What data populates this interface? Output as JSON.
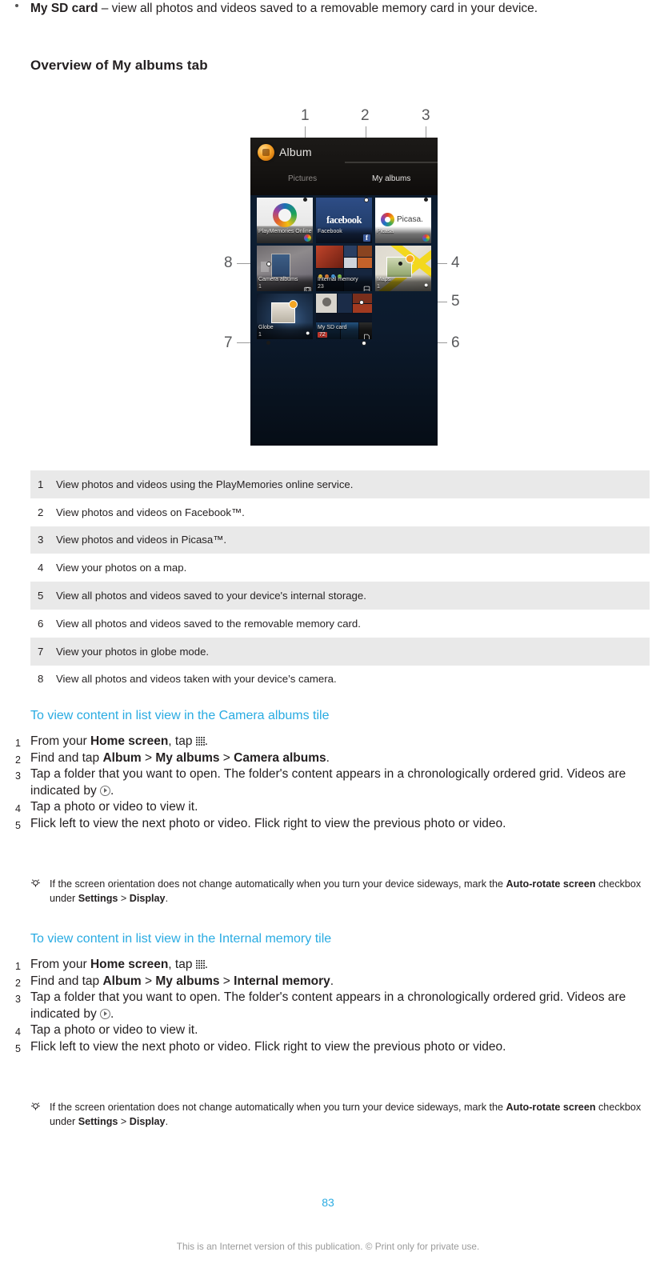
{
  "bullet": {
    "term": "My SD card",
    "rest": " – view all photos and videos saved to a removable memory card in your device."
  },
  "heading": "Overview of My albums tab",
  "figure": {
    "callout_numbers": [
      "1",
      "2",
      "3",
      "4",
      "5",
      "6",
      "7",
      "8"
    ],
    "app": {
      "title": "Album",
      "tabs": [
        {
          "label": "Pictures",
          "selected": false
        },
        {
          "label": "My albums",
          "selected": true
        }
      ],
      "tiles": [
        {
          "label": "PlayMemories Online",
          "count": "",
          "badge": "playmemories-icon"
        },
        {
          "label": "Facebook",
          "count": "",
          "badge": "facebook-icon"
        },
        {
          "label": "Picasa",
          "count": "",
          "badge": "picasa-icon"
        },
        {
          "label": "Camera albums",
          "count": "1",
          "badge": "camera-icon"
        },
        {
          "label": "Internal memory",
          "count": "23",
          "badge": "storage-icon"
        },
        {
          "label": "Maps",
          "count": "1",
          "badge": "pin-icon"
        },
        {
          "label": "Globe",
          "count": "1",
          "badge": "pin-icon"
        },
        {
          "label": "My SD card",
          "count": "72",
          "badge": "sdcard-icon"
        }
      ]
    }
  },
  "table": {
    "rows": [
      {
        "num": "1",
        "text": "View photos and videos using the PlayMemories online service."
      },
      {
        "num": "2",
        "text": "View photos and videos on Facebook™."
      },
      {
        "num": "3",
        "text": "View photos and videos in Picasa™."
      },
      {
        "num": "4",
        "text": "View your photos on a map."
      },
      {
        "num": "5",
        "text": "View all photos and videos saved to your device's internal storage."
      },
      {
        "num": "6",
        "text": "View all photos and videos saved to the removable memory card."
      },
      {
        "num": "7",
        "text": "View your photos in globe mode."
      },
      {
        "num": "8",
        "text": "View all photos and videos taken with your device’s camera."
      }
    ]
  },
  "procedures": [
    {
      "heading": "To view content in list view in the Camera albums tile",
      "steps": [
        {
          "num": "1",
          "prefix": "From your ",
          "bold1": "Home screen",
          "mid": ", tap ",
          "icon": "apps-grid-icon",
          "suffix": "."
        },
        {
          "num": "2",
          "prefix": "Find and tap ",
          "bold1": "Album",
          "sep1": " > ",
          "bold2": "My albums",
          "sep2": " > ",
          "bold3": "Camera albums",
          "suffix": "."
        },
        {
          "num": "3",
          "prefix": "Tap a folder that you want to open. The folder's content appears in a chronologically ordered grid. Videos are indicated by ",
          "icon": "play-circle-icon",
          "suffix": "."
        },
        {
          "num": "4",
          "prefix": "Tap a photo or video to view it."
        },
        {
          "num": "5",
          "prefix": "Flick left to view the next photo or video. Flick right to view the previous photo or video."
        }
      ],
      "note": {
        "icon": "tip-bulb-icon",
        "part1": "If the screen orientation does not change automatically when you turn your device sideways, mark the ",
        "bold1": "Auto-rotate screen",
        "part2": " checkbox under ",
        "bold2": "Settings",
        "part3": " > ",
        "bold3": "Display",
        "part4": "."
      }
    },
    {
      "heading": "To view content in list view in the Internal memory tile",
      "steps": [
        {
          "num": "1",
          "prefix": "From your ",
          "bold1": "Home screen",
          "mid": ", tap ",
          "icon": "apps-grid-icon",
          "suffix": "."
        },
        {
          "num": "2",
          "prefix": "Find and tap ",
          "bold1": "Album",
          "sep1": " > ",
          "bold2": "My albums",
          "sep2": " > ",
          "bold3": "Internal memory",
          "suffix": "."
        },
        {
          "num": "3",
          "prefix": "Tap a folder that you want to open. The folder's content appears in a chronologically ordered grid. Videos are indicated by ",
          "icon": "play-circle-icon",
          "suffix": "."
        },
        {
          "num": "4",
          "prefix": "Tap a photo or video to view it."
        },
        {
          "num": "5",
          "prefix": "Flick left to view the next photo or video. Flick right to view the previous photo or video."
        }
      ],
      "note": {
        "icon": "tip-bulb-icon",
        "part1": "If the screen orientation does not change automatically when you turn your device sideways, mark the ",
        "bold1": "Auto-rotate screen",
        "part2": " checkbox under ",
        "bold2": "Settings",
        "part3": " > ",
        "bold3": "Display",
        "part4": "."
      }
    }
  ],
  "page_number": "83",
  "footer": "This is an Internet version of this publication. © Print only for private use.",
  "colors": {
    "accent": "#29abe2",
    "table_shade": "#e9e9e9",
    "text": "#231f20",
    "footer_text": "#9a9a9a"
  }
}
